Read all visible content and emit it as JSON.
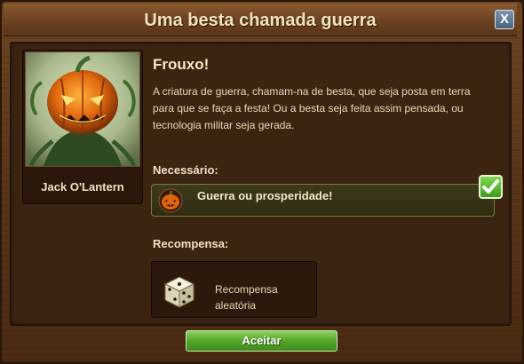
{
  "dialog": {
    "title": "Uma besta chamada guerra",
    "close_label": "X"
  },
  "character": {
    "name": "Jack O'Lantern",
    "image_icon": "pumpkin-monster-portrait"
  },
  "quest": {
    "title": "Frouxo!",
    "description": "A criatura de guerra, chamam-na de besta, que seja posta em terra para que se faça a festa! Ou a besta seja feita assim pensada, ou tecnologia militar seja gerada."
  },
  "requirements": {
    "heading": "Necessário:",
    "items": [
      {
        "label": "Guerra ou prosperidade!",
        "icon": "pumpkin-icon",
        "completed": true
      }
    ]
  },
  "rewards": {
    "heading": "Recompensa:",
    "items": [
      {
        "label": "Recompensa aleatória",
        "icon": "dice-icon"
      }
    ]
  },
  "footer": {
    "accept_label": "Aceitar"
  },
  "colors": {
    "accent_green": "#55a52b",
    "title_text": "#f4e3bd",
    "wood": "#5a3519"
  }
}
